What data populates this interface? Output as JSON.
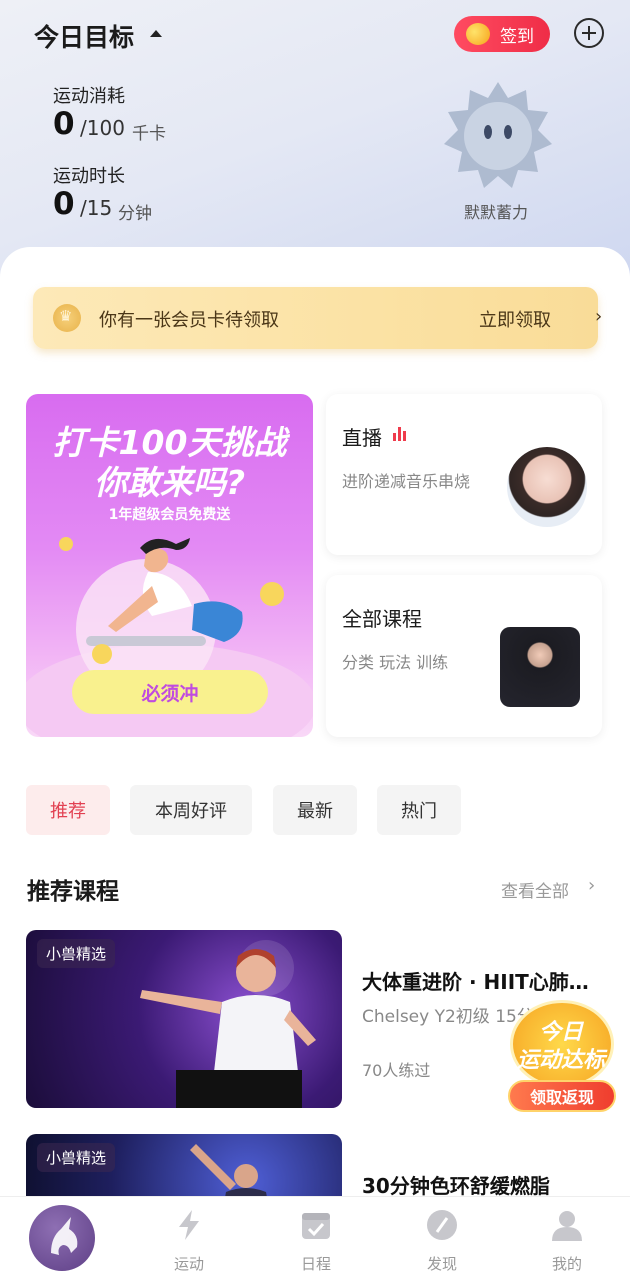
{
  "header": {
    "title": "今日目标",
    "checkin_label": "签到"
  },
  "stats": {
    "calories": {
      "label": "运动消耗",
      "value": "0",
      "goal": "/100",
      "unit": "千卡"
    },
    "duration": {
      "label": "运动时长",
      "value": "0",
      "goal": "/15",
      "unit": "分钟"
    }
  },
  "mascot": {
    "label": "默默蓄力"
  },
  "vip_bar": {
    "text": "你有一张会员卡待领取",
    "cta": "立即领取",
    "arrow": "›"
  },
  "banner": {
    "title_line1": "打卡100天挑战",
    "title_line2": "你敢来吗?",
    "subtitle": "1年超级会员免费送",
    "cta": "必须冲"
  },
  "live_card": {
    "title": "直播",
    "desc": "进阶递减音乐串烧"
  },
  "all_card": {
    "title": "全部课程",
    "desc": "分类 玩法 训练"
  },
  "filter_tabs": [
    "推荐",
    "本周好评",
    "最新",
    "热门"
  ],
  "section": {
    "title": "推荐课程",
    "more": "查看全部",
    "arrow": "›"
  },
  "courses": [
    {
      "tag": "小兽精选",
      "name": "大体重进阶 · HIIT心肺…",
      "meta": "Chelsey Y2初级 15分钟",
      "count": "70人练过"
    },
    {
      "tag": "小兽精选",
      "name": "30分钟色环舒缓燃脂"
    }
  ],
  "promo": {
    "line1": "今日",
    "line2": "运动达标",
    "button": "领取返现"
  },
  "bottom_nav": [
    {
      "label": "运动",
      "icon": "lightning-icon"
    },
    {
      "label": "日程",
      "icon": "calendar-check-icon"
    },
    {
      "label": "发现",
      "icon": "compass-icon"
    },
    {
      "label": "我的",
      "icon": "user-icon"
    }
  ],
  "colors": {
    "accent_red": "#ef2d47",
    "vip_gold": "#fbe2a4",
    "banner_purple": "#d86cf0"
  }
}
